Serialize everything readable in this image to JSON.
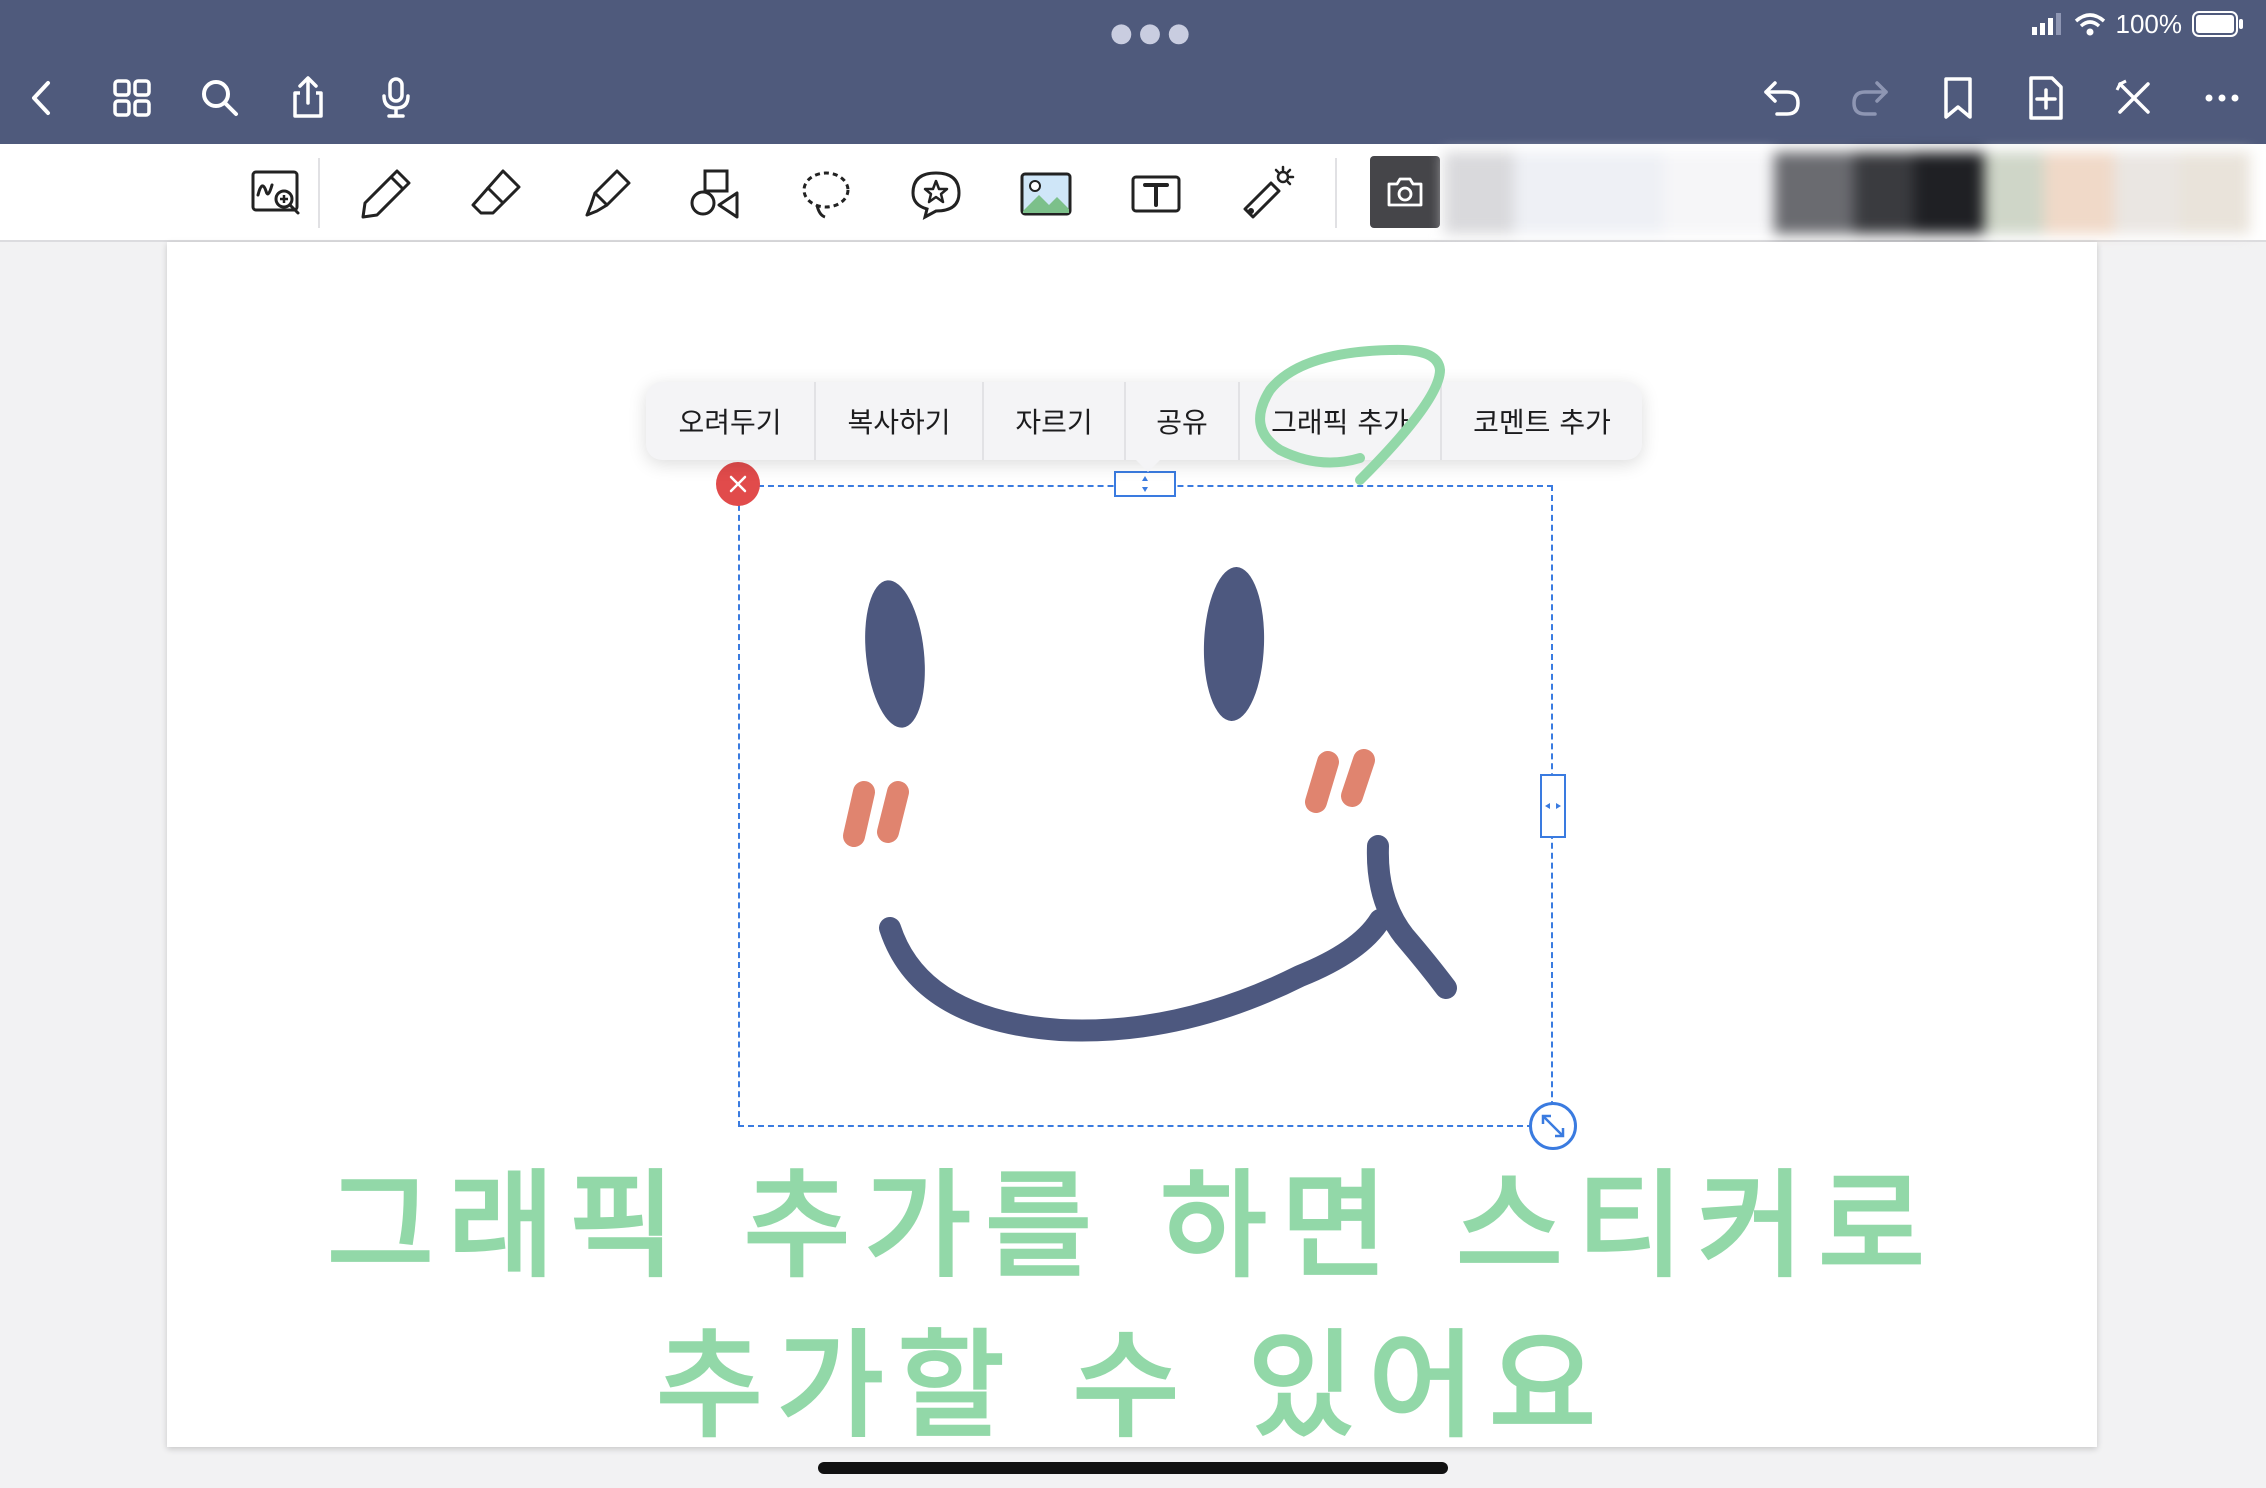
{
  "status_bar": {
    "battery_percent": "100%"
  },
  "nav": {
    "left": [
      "back-icon",
      "grid-icon",
      "search-icon",
      "share-icon",
      "microphone-icon"
    ],
    "right": [
      "undo-icon",
      "redo-icon",
      "bookmark-icon",
      "add-page-icon",
      "close-edit-icon",
      "more-icon"
    ]
  },
  "toolbar": {
    "tools": [
      "zoom-writing-icon",
      "pen-icon",
      "eraser-icon",
      "highlighter-icon",
      "shapes-icon",
      "lasso-icon",
      "sticker-icon",
      "image-icon",
      "text-icon",
      "laser-pointer-icon"
    ],
    "camera": "camera-icon"
  },
  "context_menu": {
    "items": [
      {
        "label": "오려두기"
      },
      {
        "label": "복사하기"
      },
      {
        "label": "자르기"
      },
      {
        "label": "공유"
      },
      {
        "label": "그래픽 추가"
      },
      {
        "label": "코멘트 추가"
      }
    ]
  },
  "caption": {
    "line1": "그래픽 추가를 하면 스티커로",
    "line2": "추가할 수 있어요"
  },
  "colors": {
    "nav_bar": "#4f5a7c",
    "selection": "#3a7be0",
    "delete": "#e14b4b",
    "smiley_face": "#4d587f",
    "blush": "#e0846f",
    "annotation_green": "#92d8a8"
  }
}
